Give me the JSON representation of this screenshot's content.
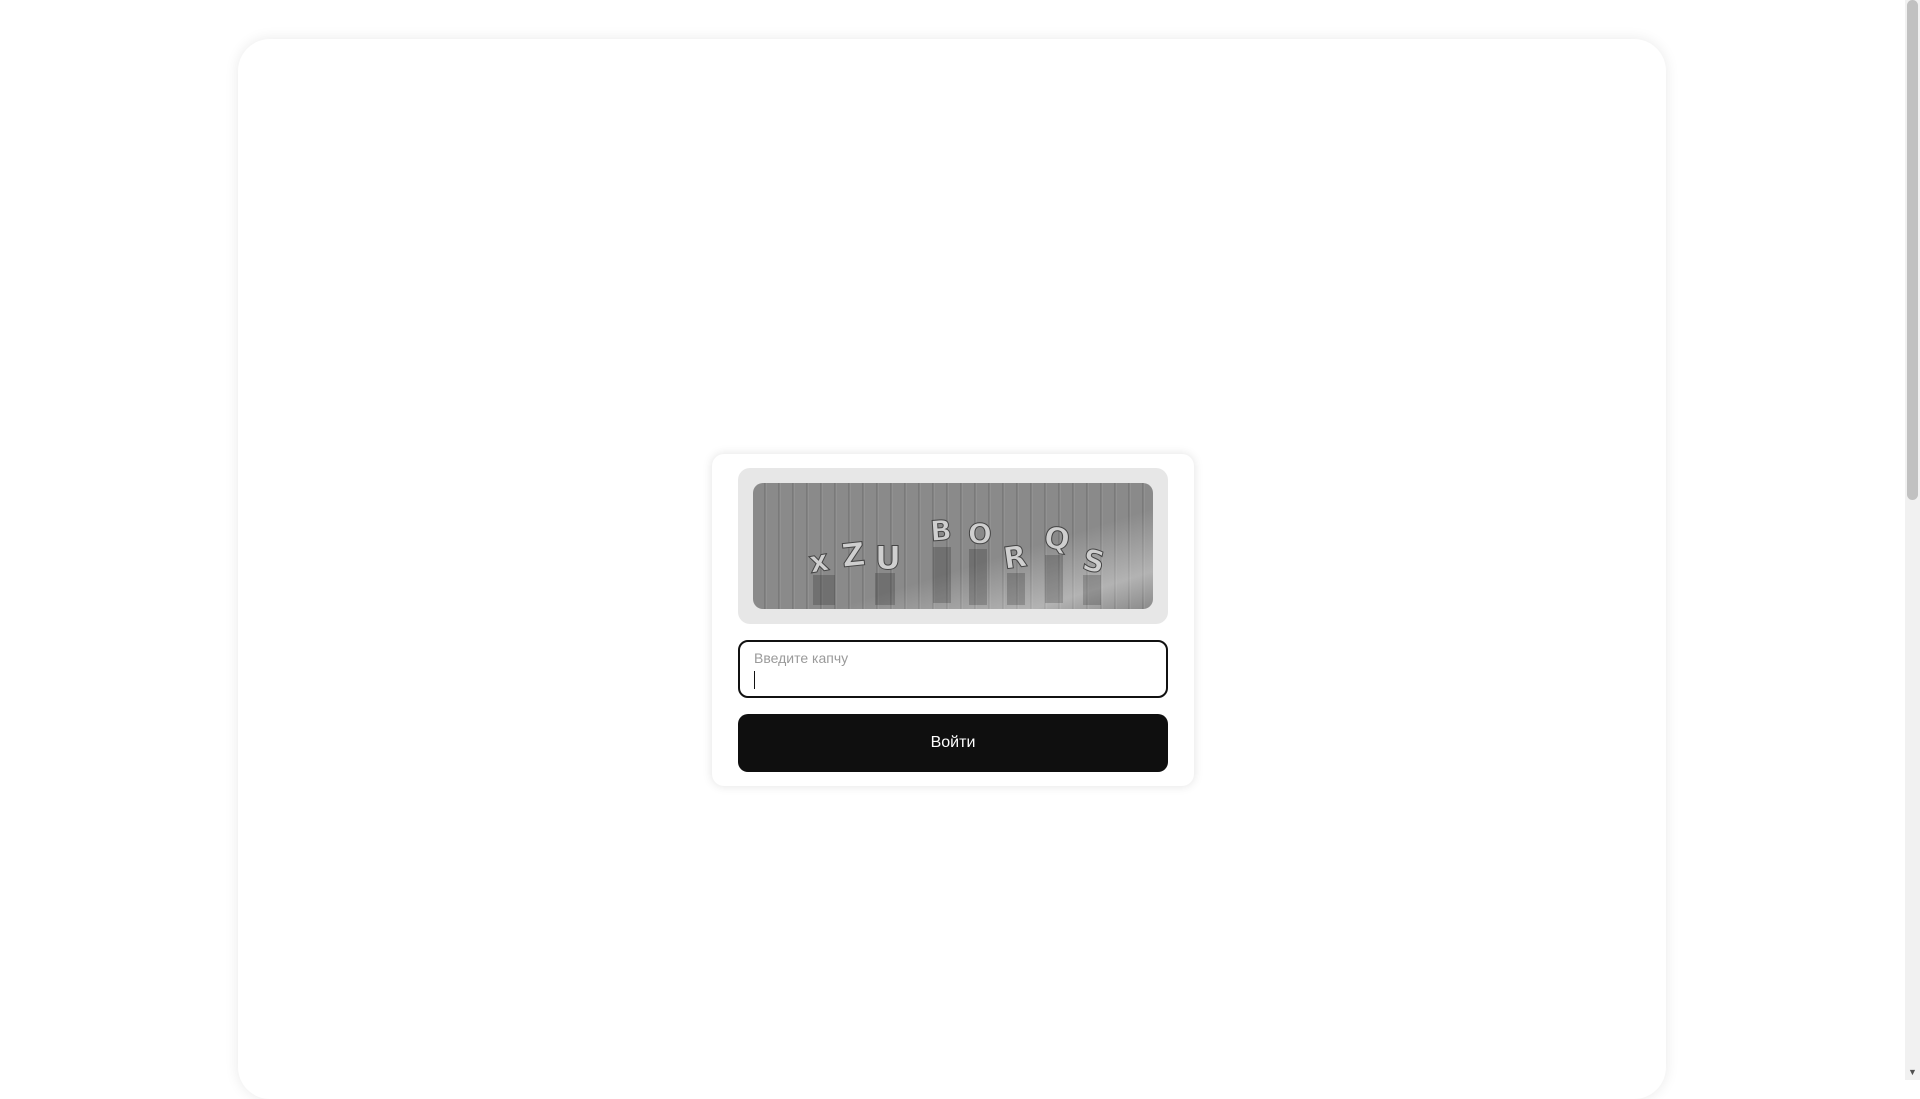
{
  "captcha": {
    "image_alt": "captcha",
    "image_text": "xZUBORQS",
    "input_label": "Введите капчу",
    "input_value": ""
  },
  "actions": {
    "submit_label": "Войти"
  },
  "icons": {
    "scroll_down": "chevron-down-icon"
  }
}
